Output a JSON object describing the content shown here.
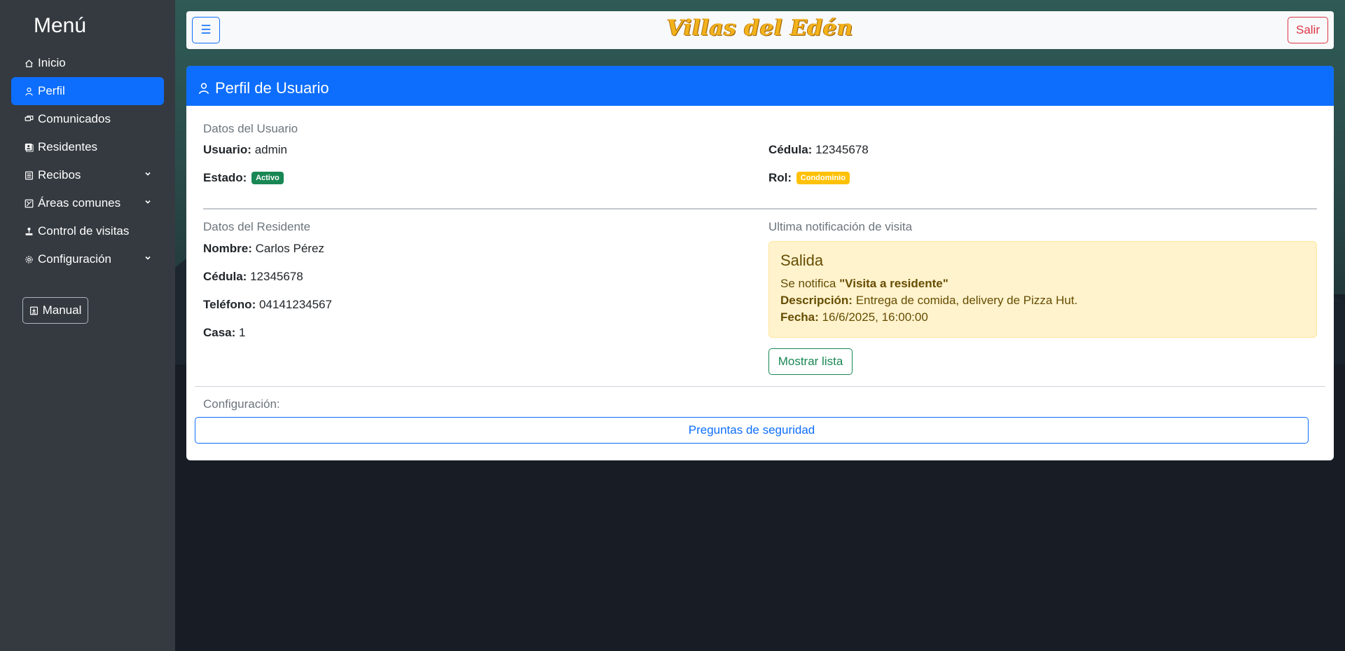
{
  "sidebar": {
    "title": "Menú",
    "items": [
      {
        "label": "Inicio",
        "icon": "home-icon"
      },
      {
        "label": "Perfil",
        "icon": "user-icon",
        "active": true
      },
      {
        "label": "Comunicados",
        "icon": "chat-icon"
      },
      {
        "label": "Residentes",
        "icon": "residents-icon"
      },
      {
        "label": "Recibos",
        "icon": "receipt-icon",
        "expandable": true
      },
      {
        "label": "Áreas comunes",
        "icon": "area-icon",
        "expandable": true
      },
      {
        "label": "Control de visitas",
        "icon": "joystick-icon"
      },
      {
        "label": "Configuración",
        "icon": "gear-icon",
        "expandable": true
      }
    ],
    "manual_label": "Manual"
  },
  "topbar": {
    "toggle_icon": "☰",
    "brand": "Villas del Edén",
    "logout_label": "Salir"
  },
  "card": {
    "title": "Perfil de Usuario",
    "user_section": {
      "title": "Datos del Usuario",
      "usuario_label": "Usuario:",
      "usuario_value": "admin",
      "cedula_label": "Cédula:",
      "cedula_value": "12345678",
      "estado_label": "Estado:",
      "estado_value": "Activo",
      "rol_label": "Rol:",
      "rol_value": "Condominio"
    },
    "resident_section": {
      "title": "Datos del Residente",
      "nombre_label": "Nombre:",
      "nombre_value": "Carlos Pérez",
      "cedula_label": "Cédula:",
      "cedula_value": "12345678",
      "telefono_label": "Teléfono:",
      "telefono_value": "04141234567",
      "casa_label": "Casa:",
      "casa_value": "1"
    },
    "notification": {
      "section_title": "Ultima notificación de visita",
      "title": "Salida",
      "notify_prefix": "Se notifica",
      "notify_value": "\"Visita a residente\"",
      "descripcion_label": "Descripción:",
      "descripcion_value": "Entrega de comida, delivery de Pizza Hut.",
      "fecha_label": "Fecha:",
      "fecha_value": "16/6/2025, 16:00:00",
      "show_list_label": "Mostrar lista"
    },
    "config": {
      "title": "Configuración:",
      "security_label": "Preguntas de seguridad"
    }
  },
  "colors": {
    "primary": "#0d6efd",
    "success": "#198754",
    "warning": "#ffc107",
    "danger": "#dc3545",
    "sidebar": "#343a40"
  }
}
